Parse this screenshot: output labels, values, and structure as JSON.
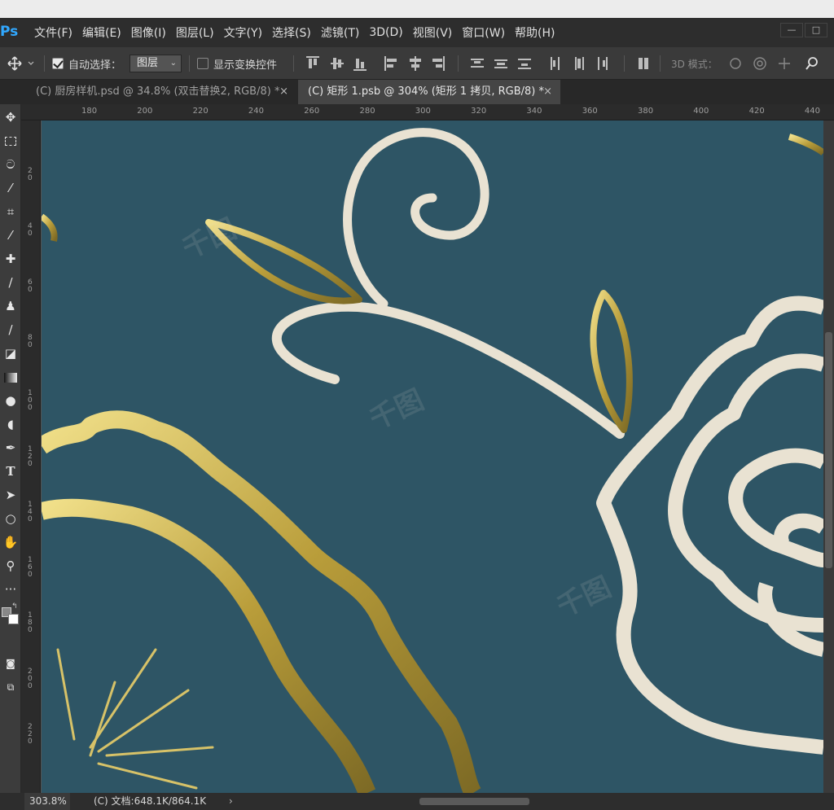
{
  "app": {
    "logo": "Ps",
    "accent_color": "#31a8ff"
  },
  "menubar": {
    "items": [
      "文件(F)",
      "编辑(E)",
      "图像(I)",
      "图层(L)",
      "文字(Y)",
      "选择(S)",
      "滤镜(T)",
      "3D(D)",
      "视图(V)",
      "窗口(W)",
      "帮助(H)"
    ],
    "window_controls": {
      "minimize": "—",
      "restore": "□"
    }
  },
  "options": {
    "move_icon": "move-icon",
    "auto_select_label": "自动选择：",
    "auto_select_checked": true,
    "auto_select_target": "图层",
    "show_transform_label": "显示变换控件",
    "show_transform_checked": false,
    "mode_3d_label": "3D 模式："
  },
  "tabs": [
    {
      "label": "(C) 厨房样机.psd @ 34.8% (双击替换2, RGB/8) *",
      "close": "×",
      "active": false
    },
    {
      "label": "(C) 矩形 1.psb @ 304% (矩形 1 拷贝, RGB/8) *",
      "close": "×",
      "active": true
    }
  ],
  "tools": [
    "move-tool-icon",
    "marquee-tool-icon",
    "lasso-tool-icon",
    "magic-wand-tool-icon",
    "crop-tool-icon",
    "eyedropper-tool-icon",
    "healing-brush-tool-icon",
    "brush-tool-icon",
    "clone-stamp-tool-icon",
    "history-brush-tool-icon",
    "eraser-tool-icon",
    "gradient-tool-icon",
    "blur-tool-icon",
    "dodge-tool-icon",
    "pen-tool-icon",
    "type-tool-icon",
    "path-selection-tool-icon",
    "ellipse-tool-icon",
    "hand-tool-icon",
    "zoom-tool-icon",
    "more-tools-icon"
  ],
  "rulers": {
    "horizontal": [
      "180",
      "200",
      "220",
      "240",
      "260",
      "280",
      "300",
      "320",
      "340",
      "360",
      "380",
      "400",
      "420",
      "440"
    ],
    "vertical": [
      "20",
      "40",
      "60",
      "80",
      "100",
      "120",
      "140",
      "160",
      "180",
      "200",
      "220"
    ]
  },
  "canvas": {
    "background": "#2e5565",
    "cream_color": "#e9e2d2",
    "gold_color": "#c8b24c",
    "watermark_text": "千图"
  },
  "status": {
    "zoom": "303.8%",
    "doc_info": "(C) 文档:648.1K/864.1K",
    "arrow": "›"
  }
}
